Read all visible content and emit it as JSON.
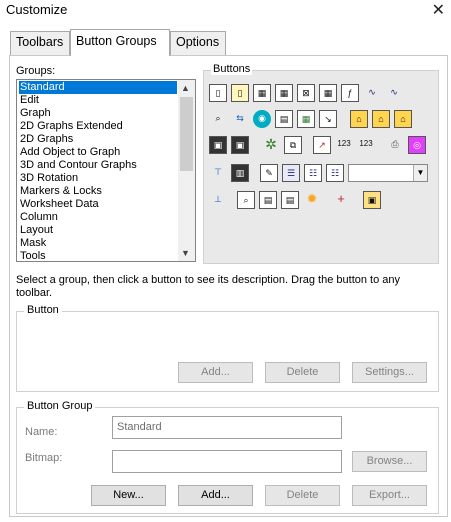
{
  "window": {
    "title": "Customize",
    "close_glyph": "✕"
  },
  "tabs": [
    {
      "label": "Toolbars",
      "active": false
    },
    {
      "label": "Button Groups",
      "active": true
    },
    {
      "label": "Options",
      "active": false
    }
  ],
  "groups": {
    "label": "Groups:",
    "items": [
      "Standard",
      "Edit",
      "Graph",
      "2D Graphs Extended",
      "2D Graphs",
      "Add Object to Graph",
      "3D and Contour Graphs",
      "3D Rotation",
      "Markers & Locks",
      "Worksheet Data",
      "Column",
      "Layout",
      "Mask",
      "Tools"
    ],
    "selected": "Standard"
  },
  "buttons_panel": {
    "label": "Buttons",
    "icons": [
      "new-project-icon",
      "new-worksheet-icon",
      "new-matrix-icon",
      "new-graph-icon",
      "new-excel-icon",
      "new-layout-icon",
      "new-function-icon",
      "new-notes-icon",
      "new-script-icon",
      "find-icon",
      "import-icon",
      "import-wizard-icon",
      "open-template-icon",
      "open-excel-icon",
      "import-ascii-icon",
      "open-icon",
      "open-folder-icon",
      "open-image-icon",
      "save-icon",
      "save-template-icon",
      "recalculate-icon",
      "duplicate-icon",
      "batch-plot-icon",
      "import-multiple-icon",
      "import-single-icon",
      "print-icon",
      "refresh-icon",
      "project-explorer-icon",
      "results-log-icon",
      "code-builder-icon",
      "command-window-icon",
      "message-log-icon",
      "script-window-icon",
      "hierarchy-icon",
      "zoom-icon",
      "report-icon",
      "notes-icon",
      "settings-icon",
      "add-column-icon",
      "package-icon"
    ]
  },
  "description": "Select a group, then click a button to see its description. Drag the button to any toolbar.",
  "button_section": {
    "label": "Button",
    "add_label": "Add...",
    "delete_label": "Delete",
    "settings_label": "Settings..."
  },
  "button_group_section": {
    "label": "Button Group",
    "name_label": "Name:",
    "name_value": "Standard",
    "bitmap_label": "Bitmap:",
    "bitmap_value": "",
    "browse_label": "Browse...",
    "new_label": "New...",
    "add_label": "Add...",
    "delete_label": "Delete",
    "export_label": "Export..."
  }
}
